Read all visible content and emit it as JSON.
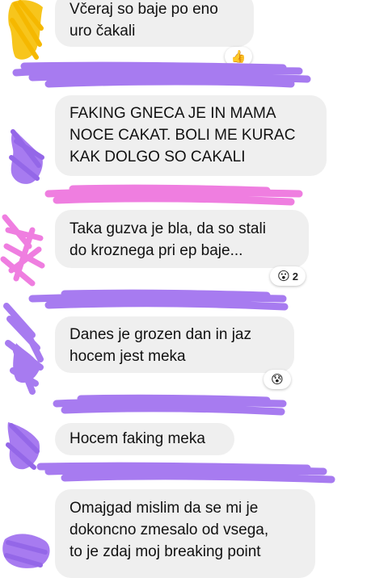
{
  "messages": [
    {
      "lines": [
        "Včeraj so baje po eno",
        "uro čakali"
      ],
      "reaction": {
        "emoji": "👍",
        "icon": "thumbs-up-icon",
        "count": ""
      }
    },
    {
      "lines": [
        "FAKING GNECA JE IN MAMA",
        "NOCE CAKAT. BOLI ME KURAC",
        "KAK DOLGO SO CAKALI"
      ]
    },
    {
      "lines": [
        "Taka guzva je bla, da so stali",
        "do kroznega pri ep baje..."
      ],
      "reaction": {
        "emoji": "😮",
        "icon": "astonished-face-icon",
        "count": "2"
      }
    },
    {
      "lines": [
        "Danes je grozen dan in jaz",
        "hocem jest meka"
      ],
      "reaction": {
        "emoji": "😰",
        "icon": "anxious-face-icon",
        "count": ""
      }
    },
    {
      "lines": [
        "Hocem faking meka"
      ]
    },
    {
      "lines": [
        "Omajgad mislim da se mi je",
        "dokoncno zmesalo od vsega,",
        "to je zdaj moj breaking point"
      ]
    }
  ],
  "colors": {
    "bubble_bg": "#efefef",
    "scribble_purple": "#a77bf0",
    "scribble_pink": "#ef7ee0",
    "scribble_yellow": "#f7c51c"
  }
}
